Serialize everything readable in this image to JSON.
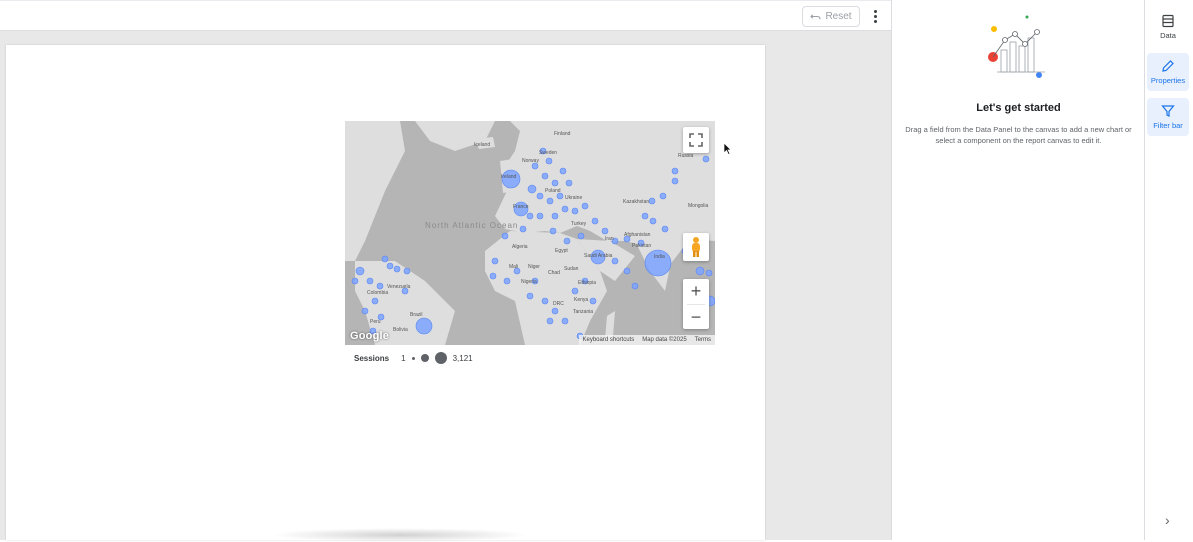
{
  "toolbar": {
    "reset_label": "Reset"
  },
  "map": {
    "ocean_label": "North Atlantic Ocean",
    "labels": [
      "Iceland",
      "Finland",
      "Norway",
      "Sweden",
      "Russia",
      "Ireland",
      "Poland",
      "France",
      "Ukraine",
      "Kazakhstan",
      "Mongolia",
      "Turkey",
      "Iran",
      "Afghanistan",
      "Pakistan",
      "Saudi Arabia",
      "India",
      "Egypt",
      "Algeria",
      "Mali",
      "Niger",
      "Sudan",
      "Chad",
      "Ethiopia",
      "Nigeria",
      "DRC",
      "Kenya",
      "Tanzania",
      "Venezuela",
      "Colombia",
      "Peru",
      "Brazil",
      "Bolivia"
    ],
    "google_logo": "Google",
    "footer": [
      "Keyboard shortcuts",
      "Map data ©2025",
      "Terms"
    ],
    "bubble_color": "#7ba3ff"
  },
  "legend": {
    "title": "Sessions",
    "min": "1",
    "max": "3,121"
  },
  "panel": {
    "heading": "Let's get started",
    "description": "Drag a field from the Data Panel to the canvas to add a new chart or select a component on the report canvas to edit it."
  },
  "rail": {
    "data_label": "Data",
    "properties_label": "Properties",
    "filter_label": "Filter bar"
  }
}
